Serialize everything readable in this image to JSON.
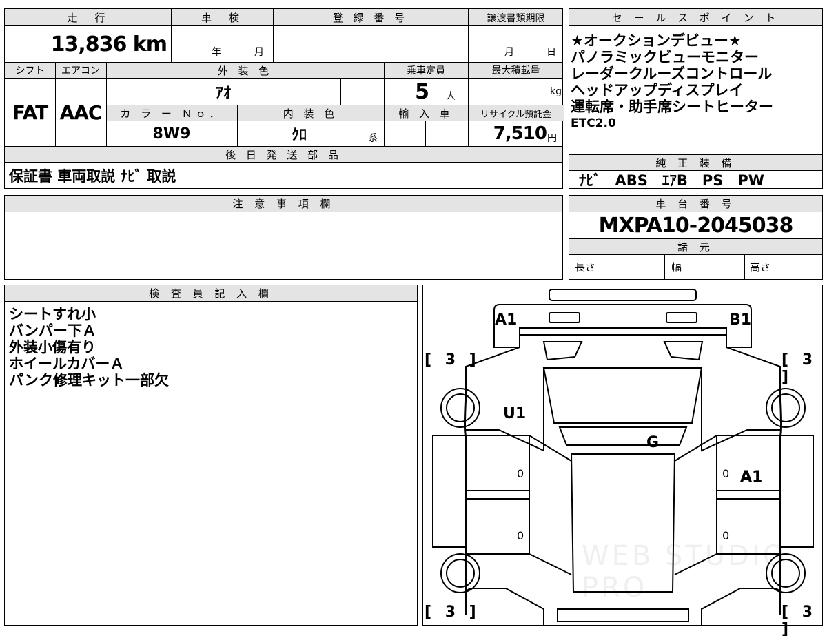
{
  "top_section": {
    "headers": {
      "mileage": "走　行",
      "inspection": "車　検",
      "registration": "登 録 番 号",
      "transfer_deadline": "譲渡書類期限",
      "shift": "シフト",
      "aircon": "エアコン",
      "exterior_color": "外 装 色",
      "capacity": "乗車定員",
      "max_load": "最大積載量",
      "color_no": "カ ラ ー Ｎｏ．",
      "interior_color": "内 装 色",
      "imported": "輸 入 車",
      "recycle_fee": "リサイクル預託金",
      "later_parts": "後 日 発 送 部 品"
    },
    "values": {
      "mileage": "13,836 km",
      "inspection_year_unit": "年",
      "inspection_month_unit": "月",
      "transfer_month_unit": "月",
      "transfer_day_unit": "日",
      "shift": "FAT",
      "aircon": "AAC",
      "exterior_color": "ｱｵ",
      "capacity_value": "5",
      "capacity_unit": "人",
      "max_load_unit": "kg",
      "color_no": "8W9",
      "interior_color": "ｸﾛ",
      "interior_suffix": "系",
      "recycle_fee_value": "7,510",
      "recycle_fee_unit": "円",
      "later_parts": "保証書 車両取説 ﾅﾋﾞ 取説"
    }
  },
  "sales_points": {
    "header": "セ ー ル ス ポ イ ン ト",
    "items": [
      "★オークションデビュー★",
      "パノラミックビューモニター",
      "レーダークルーズコントロール",
      "ヘッドアップディスプレイ",
      "運転席・助手席シートヒーター",
      "ETC2.0"
    ]
  },
  "genuine_equipment": {
    "header": "純 正 装 備",
    "value": "ﾅﾋﾞ　ABS　ｴｱB　PS　PW"
  },
  "notes": {
    "header": "注 意 事 項 欄",
    "value": ""
  },
  "chassis": {
    "header": "車 台 番 号",
    "value": "MXPA10-2045038"
  },
  "specs": {
    "header": "諸 元",
    "length_label": "長さ",
    "width_label": "幅",
    "height_label": "高さ"
  },
  "inspector": {
    "header": "検 査 員 記 入 欄",
    "lines": [
      "シートすれ小",
      "バンパー下Ａ",
      "外装小傷有り",
      "ホイールカバーＡ",
      "パンク修理キット一部欠"
    ]
  },
  "car_diagram": {
    "marks": {
      "front_left": "A1",
      "front_right": "B1",
      "left_fender": "U1",
      "roof": "G",
      "right_rear_door": "A1"
    },
    "tire_tl": "[ 3 ]",
    "tire_tr": "[ 3 ]",
    "tire_bl": "[ 3 ]",
    "tire_br": "[ 3 ]",
    "door_marks": [
      "0",
      "0",
      "0",
      "0"
    ],
    "watermark": "WEB STUDIO PRO"
  }
}
